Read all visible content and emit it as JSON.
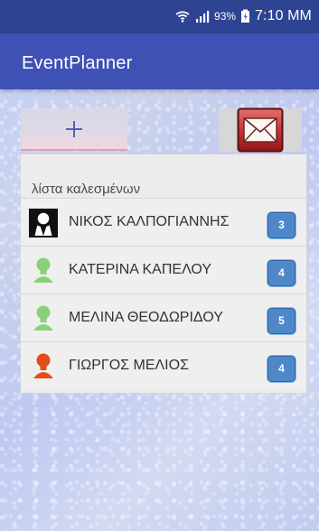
{
  "status_bar": {
    "battery": "93%",
    "time": "7:10 MM",
    "icons": [
      "wifi-icon",
      "signal-icon",
      "battery-icon"
    ]
  },
  "app": {
    "title": "EventPlanner"
  },
  "actions": {
    "add_icon": "plus-icon",
    "mail_icon": "mail-icon"
  },
  "guest_list": {
    "title": "λίστα καλεσμένων",
    "items": [
      {
        "name": "ΝΙΚΟΣ ΚΑΛΠΟΓΙΑΝΝΗΣ",
        "count": "3",
        "avatar": "black-person-icon"
      },
      {
        "name": "ΚΑΤΕΡΙΝΑ ΚΑΠΕΛΟΥ",
        "count": "4",
        "avatar": "green-person-icon"
      },
      {
        "name": "ΜΕΛΙΝΑ ΘΕΟΔΩΡΙΔΟΥ",
        "count": "5",
        "avatar": "green-person-icon"
      },
      {
        "name": "ΓΙΩΡΓΟΣ ΜΕΛΙΟΣ",
        "count": "4",
        "avatar": "orange-person-icon"
      }
    ]
  },
  "colors": {
    "status_bar": "#2f4393",
    "app_bar": "#3f51b5",
    "badge": "#4e88c9",
    "mail_red": "#c83535"
  }
}
